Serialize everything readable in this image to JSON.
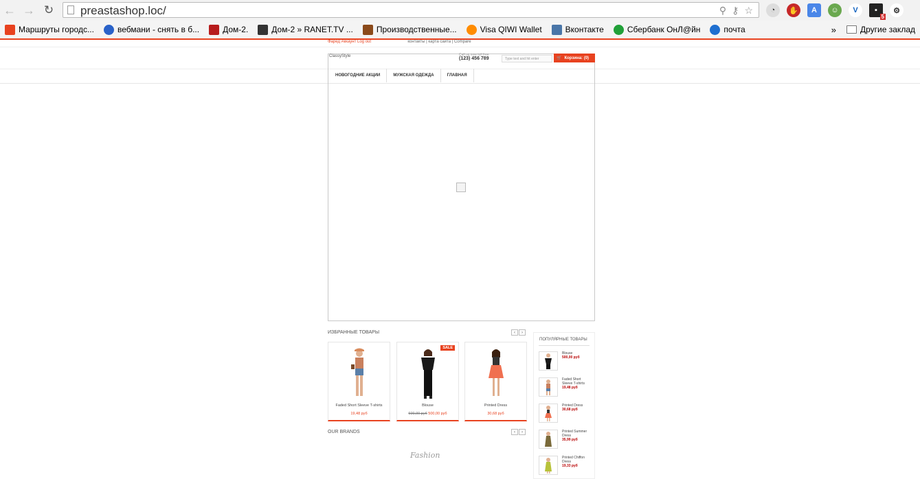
{
  "browser": {
    "url": "preastashop.loc/",
    "bookmarks": [
      {
        "label": "Маршруты городс...",
        "color": "#e8421f"
      },
      {
        "label": "вебмани - снять в б...",
        "color": "#2a62c9"
      },
      {
        "label": "Дом-2.",
        "color": "#b71c1c"
      },
      {
        "label": "Дом-2 » RANET.TV ...",
        "color": "#333333"
      },
      {
        "label": "Производственные...",
        "color": "#8b4a1a"
      },
      {
        "label": "Visa QIWI Wallet",
        "color": "#ff8c00"
      },
      {
        "label": "Вконтакте",
        "color": "#4a76a8"
      },
      {
        "label": "Сбербанк ОнЛ@йн",
        "color": "#21a038"
      },
      {
        "label": "почта",
        "color": "#1f6fd0"
      }
    ],
    "more": "»",
    "other_bookmarks": "Другие заклад",
    "extension_badge": "5"
  },
  "shop": {
    "toplinks_red": "Фаред  Аккаунт  Log out",
    "toplinks_grey": "контакты  |  карта сайта  |  Compare",
    "logo": "ClassyStyle",
    "phone_label": "Call us now toll free",
    "phone": "(123) 456 789",
    "search_placeholder": "Type text and hit enter",
    "cart_label": "Корзина: (0)",
    "menu": [
      "НОВОГОДНИЕ АКЦИИ",
      "МУЖСКАЯ ОДЕЖДА",
      "ГЛАВНАЯ"
    ],
    "featured_title": "ИЗБРАННЫЕ ТОВАРЫ",
    "brands_title": "OUR BRANDS",
    "brand_name": "Fashion",
    "sale_badge": "SALE",
    "products": [
      {
        "name": "Faded Short Sleeve T-shirts",
        "price": "19,48 руб",
        "old_price": "",
        "dress": "#c9805e"
      },
      {
        "name": "Blouse",
        "price": "500,00 руб",
        "old_price": "600,00 руб",
        "dress": "#1a1a1a"
      },
      {
        "name": "Printed Dress",
        "price": "30,68 руб",
        "old_price": "",
        "dress": "#f07050"
      }
    ],
    "popular_title": "ПОПУЛЯРНЫЕ ТОВАРЫ",
    "popular": [
      {
        "name": "Blouse",
        "price": "500,00 руб",
        "color": "#1a1a1a"
      },
      {
        "name": "Faded Short Sleeve T-shirts",
        "price": "19,48 руб",
        "color": "#c9805e"
      },
      {
        "name": "Printed Dress",
        "price": "30,68 руб",
        "color": "#f07050"
      },
      {
        "name": "Printed Summer Dress",
        "price": "35,99 руб",
        "color": "#7a6a3a"
      },
      {
        "name": "Printed Chiffon Dress",
        "price": "19,33 руб",
        "color": "#b8c23a"
      }
    ]
  }
}
